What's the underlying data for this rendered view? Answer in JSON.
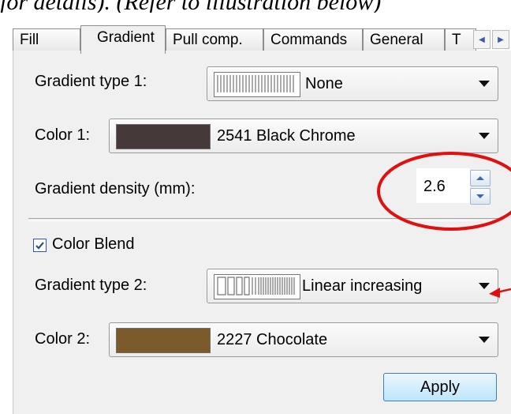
{
  "caption": "for details). (Refer to illustration below)",
  "tabs": [
    {
      "label": "Fill",
      "active": false
    },
    {
      "label": "Gradient",
      "active": true
    },
    {
      "label": "Pull comp.",
      "active": false
    },
    {
      "label": "Commands",
      "active": false
    },
    {
      "label": "General",
      "active": false
    },
    {
      "label": "T",
      "active": false
    }
  ],
  "gradient_type_1": {
    "label": "Gradient type 1:",
    "value": "None"
  },
  "color_1": {
    "label": "Color 1:",
    "value": "2541 Black Chrome",
    "swatch": "#45393a"
  },
  "gradient_density": {
    "label": "Gradient density (mm):",
    "value": "2.6"
  },
  "color_blend": {
    "label": "Color Blend",
    "checked": true
  },
  "gradient_type_2": {
    "label": "Gradient type 2:",
    "value": "Linear increasing"
  },
  "color_2": {
    "label": "Color 2:",
    "value": "2227 Chocolate",
    "swatch": "#7b5a2c"
  },
  "apply_button": {
    "label": "Apply"
  },
  "colors": {
    "annotation": "#e01010",
    "accent": "#3c7fb1"
  }
}
